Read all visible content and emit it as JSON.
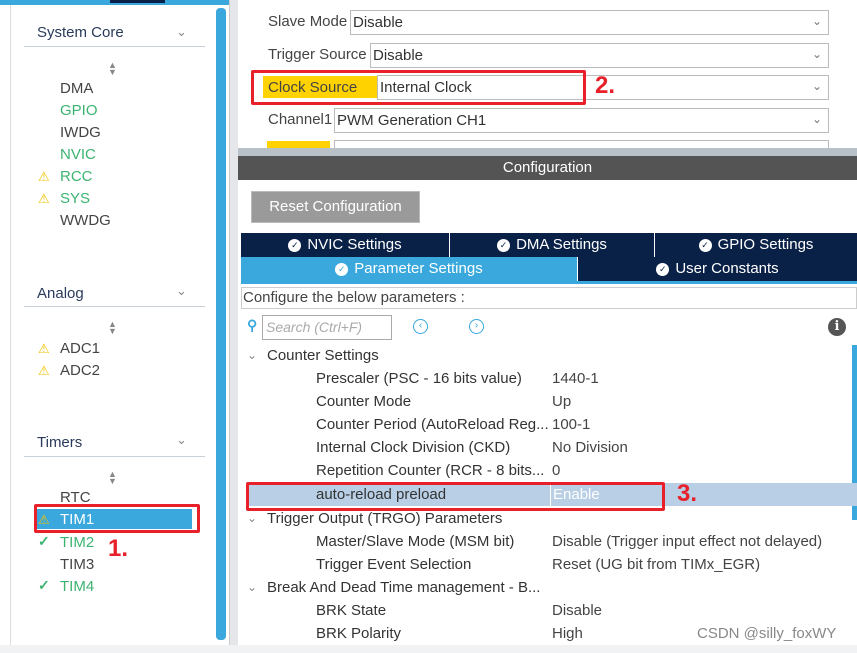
{
  "sidebar": {
    "sections": [
      {
        "title": "System Core",
        "items": [
          {
            "label": "DMA",
            "status": "none"
          },
          {
            "label": "GPIO",
            "status": "ok"
          },
          {
            "label": "IWDG",
            "status": "none"
          },
          {
            "label": "NVIC",
            "status": "ok"
          },
          {
            "label": "RCC",
            "status": "warning"
          },
          {
            "label": "SYS",
            "status": "warning"
          },
          {
            "label": "WWDG",
            "status": "none"
          }
        ]
      },
      {
        "title": "Analog",
        "items": [
          {
            "label": "ADC1",
            "status": "warning"
          },
          {
            "label": "ADC2",
            "status": "warning"
          }
        ]
      },
      {
        "title": "Timers",
        "items": [
          {
            "label": "RTC",
            "status": "none"
          },
          {
            "label": "TIM1",
            "status": "warning",
            "selected": true
          },
          {
            "label": "TIM2",
            "status": "check"
          },
          {
            "label": "TIM3",
            "status": "none"
          },
          {
            "label": "TIM4",
            "status": "check"
          }
        ]
      }
    ]
  },
  "mode": {
    "fields": [
      {
        "label": "Slave Mode",
        "value": "Disable"
      },
      {
        "label": "Trigger Source",
        "value": "Disable"
      },
      {
        "label": "Clock Source",
        "value": "Internal Clock"
      },
      {
        "label": "Channel1",
        "value": "PWM Generation CH1"
      }
    ]
  },
  "annotations": {
    "one": "1.",
    "two": "2.",
    "three": "3."
  },
  "config": {
    "header": "Configuration",
    "reset_label": "Reset Configuration",
    "tabs_row1": [
      "NVIC Settings",
      "DMA Settings",
      "GPIO Settings"
    ],
    "tabs_row2": [
      "Parameter Settings",
      "User Constants"
    ],
    "active_tab": "Parameter Settings",
    "hint": "Configure the below parameters :",
    "search_placeholder": "Search (Ctrl+F)",
    "groups": [
      {
        "title": "Counter Settings",
        "params": [
          {
            "name": "Prescaler (PSC - 16 bits value)",
            "value": "1440-1"
          },
          {
            "name": "Counter Mode",
            "value": "Up"
          },
          {
            "name": "Counter Period (AutoReload Reg...",
            "value": "100-1"
          },
          {
            "name": "Internal Clock Division (CKD)",
            "value": "No Division"
          },
          {
            "name": "Repetition Counter (RCR - 8 bits...",
            "value": "0"
          },
          {
            "name": "auto-reload preload",
            "value": "Enable",
            "selected": true
          }
        ]
      },
      {
        "title": "Trigger Output (TRGO) Parameters",
        "params": [
          {
            "name": "Master/Slave Mode (MSM bit)",
            "value": "Disable (Trigger input effect not delayed)"
          },
          {
            "name": "Trigger Event Selection",
            "value": "Reset (UG bit from TIMx_EGR)"
          }
        ]
      },
      {
        "title": "Break And Dead Time management - B...",
        "params": [
          {
            "name": "BRK State",
            "value": "Disable"
          },
          {
            "name": "BRK Polarity",
            "value": "High"
          }
        ]
      }
    ]
  },
  "watermark": "CSDN @silly_foxWY",
  "colors": {
    "accent": "#3aa8dc",
    "navy": "#0a2147",
    "highlight": "#ffd200",
    "annotation": "#e8202a",
    "selected_row": "#b8cfe6"
  }
}
